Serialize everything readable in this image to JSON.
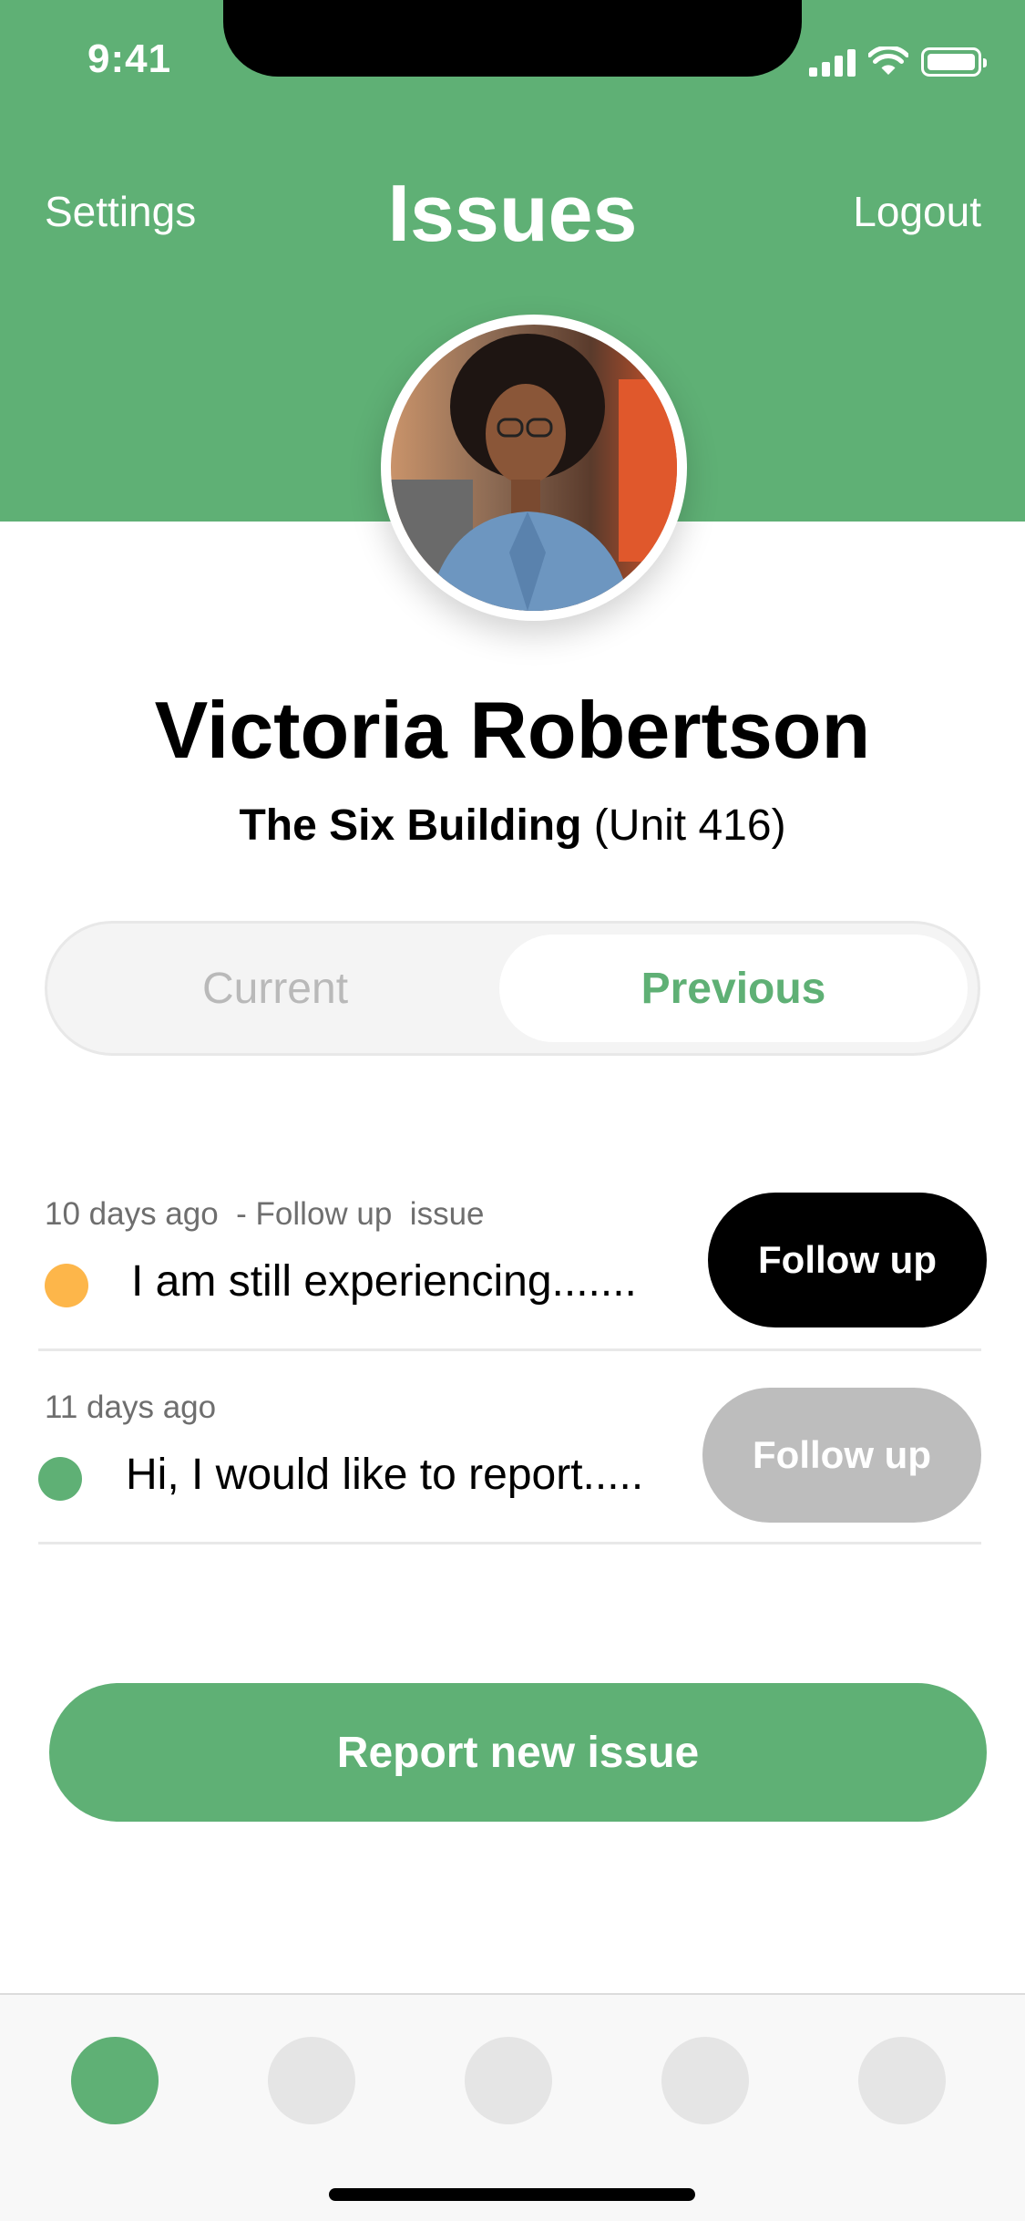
{
  "status_bar": {
    "time": "9:41"
  },
  "header": {
    "title": "Issues",
    "left_action": "Settings",
    "right_action": "Logout",
    "background": "#5fb075"
  },
  "profile": {
    "name": "Victoria Robertson",
    "building": "The Six Building",
    "unit": "(Unit 416)",
    "avatar_icon": "user-photo"
  },
  "segment": {
    "tabs": [
      "Current",
      "Previous"
    ],
    "selected": "Previous"
  },
  "issues": [
    {
      "time": "10 days ago",
      "tag": "- Follow up  issue",
      "text": "I am still experiencing.......",
      "status_color": "#fdb64a",
      "button_label": "Follow up",
      "button_color": "#000000"
    },
    {
      "time": "11 days ago",
      "tag": "",
      "text": "Hi, I would like to report.....",
      "status_color": "#5fb075",
      "button_label": "Follow up",
      "button_color": "#bdbdbd"
    }
  ],
  "report_button": {
    "label": "Report new issue"
  },
  "tab_bar": {
    "active_index": 0,
    "active_color": "#5fb075",
    "inactive_color": "#e5e5e5",
    "tabs": 5
  },
  "colors": {
    "primary": "#5fb075",
    "muted": "#b9b9b9"
  }
}
